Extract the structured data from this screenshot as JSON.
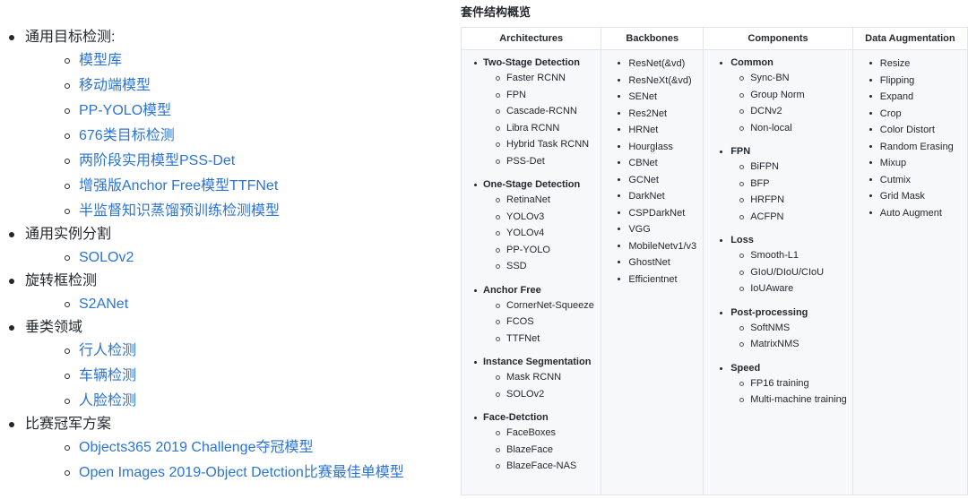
{
  "left_list": [
    {
      "label": "通用目标检测:",
      "children": [
        "模型库",
        "移动端模型",
        "PP-YOLO模型",
        "676类目标检测",
        "两阶段实用模型PSS-Det",
        "增强版Anchor Free模型TTFNet",
        "半监督知识蒸馏预训练检测模型"
      ]
    },
    {
      "label": "通用实例分割",
      "children": [
        "SOLOv2"
      ]
    },
    {
      "label": "旋转框检测",
      "children": [
        "S2ANet"
      ]
    },
    {
      "label": "垂类领域",
      "children": [
        "行人检测",
        "车辆检测",
        "人脸检测"
      ]
    },
    {
      "label": "比赛冠军方案",
      "children": [
        "Objects365 2019 Challenge夺冠模型",
        "Open Images 2019-Object Detction比赛最佳单模型"
      ]
    }
  ],
  "overview": {
    "title": "套件结构概览",
    "headers": [
      "Architectures",
      "Backbones",
      "Components",
      "Data Augmentation"
    ],
    "architectures": [
      {
        "label": "Two-Stage Detection",
        "items": [
          "Faster RCNN",
          "FPN",
          "Cascade-RCNN",
          "Libra RCNN",
          "Hybrid Task RCNN",
          "PSS-Det"
        ]
      },
      {
        "label": "One-Stage Detection",
        "items": [
          "RetinaNet",
          "YOLOv3",
          "YOLOv4",
          "PP-YOLO",
          "SSD"
        ]
      },
      {
        "label": "Anchor Free",
        "items": [
          "CornerNet-Squeeze",
          "FCOS",
          "TTFNet"
        ]
      },
      {
        "label": "Instance Segmentation",
        "items": [
          "Mask RCNN",
          "SOLOv2"
        ]
      },
      {
        "label": "Face-Detction",
        "items": [
          "FaceBoxes",
          "BlazeFace",
          "BlazeFace-NAS"
        ]
      }
    ],
    "backbones": [
      "ResNet(&vd)",
      "ResNeXt(&vd)",
      "SENet",
      "Res2Net",
      "HRNet",
      "Hourglass",
      "CBNet",
      "GCNet",
      "DarkNet",
      "CSPDarkNet",
      "VGG",
      "MobileNetv1/v3",
      "GhostNet",
      "Efficientnet"
    ],
    "components": [
      {
        "label": "Common",
        "items": [
          "Sync-BN",
          "Group Norm",
          "DCNv2",
          "Non-local"
        ]
      },
      {
        "label": "FPN",
        "items": [
          "BiFPN",
          "BFP",
          "HRFPN",
          "ACFPN"
        ]
      },
      {
        "label": "Loss",
        "items": [
          "Smooth-L1",
          "GIoU/DIoU/CIoU",
          "IoUAware"
        ]
      },
      {
        "label": "Post-processing",
        "items": [
          "SoftNMS",
          "MatrixNMS"
        ]
      },
      {
        "label": "Speed",
        "items": [
          "FP16 training",
          "Multi-machine training"
        ]
      }
    ],
    "data_augmentation": [
      "Resize",
      "Flipping",
      "Expand",
      "Crop",
      "Color Distort",
      "Random Erasing",
      "Mixup",
      "Cutmix",
      "Grid Mask",
      "Auto Augment"
    ]
  },
  "colors": {
    "link": "#2b74d6",
    "text": "#24292e",
    "table_border": "#e1e4e8",
    "table_cell_bg": "#f6f8fa"
  }
}
